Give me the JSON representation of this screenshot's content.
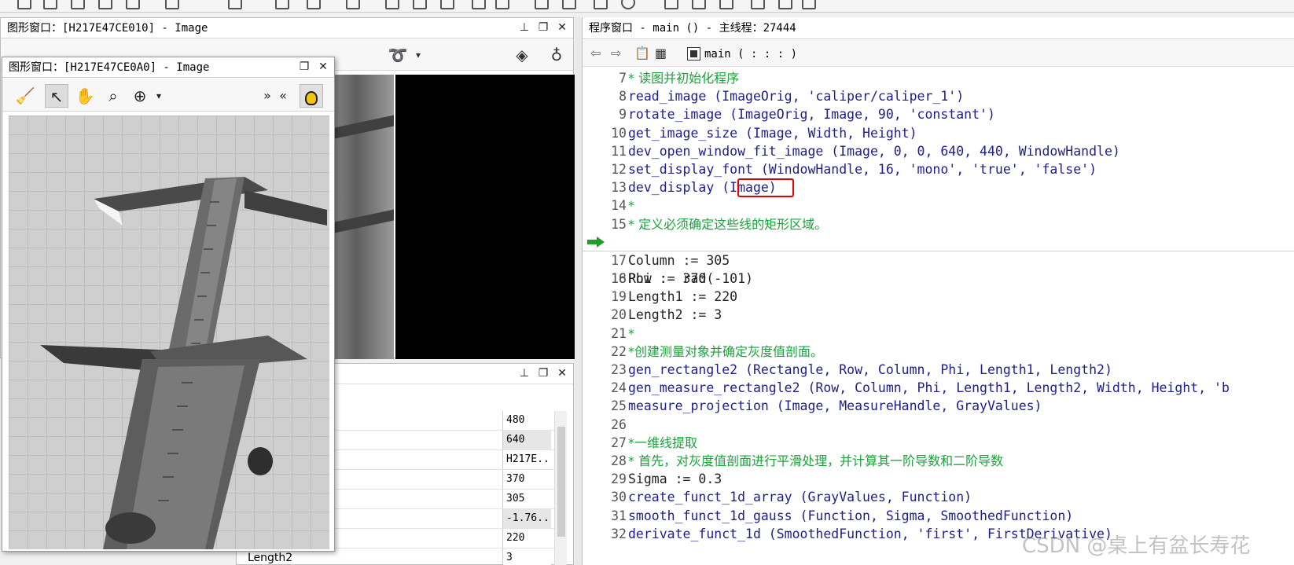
{
  "back_window": {
    "title": "图形窗口：[H217E47CE010] - Image"
  },
  "front_window": {
    "title": "图形窗口：[H217E47CE0A0] - Image"
  },
  "variable_window": {
    "rows": [
      {
        "name": "",
        "value": "480"
      },
      {
        "name": "",
        "value": "640"
      },
      {
        "name": "",
        "value": "H217E..."
      },
      {
        "name": "",
        "value": "370"
      },
      {
        "name": "",
        "value": "305"
      },
      {
        "name": "",
        "value": "-1.76..."
      },
      {
        "name": "",
        "value": "220"
      },
      {
        "name": "Length2",
        "value": "3"
      }
    ]
  },
  "program_window": {
    "title": "程序窗口 - main () - 主线程：27444",
    "procedure": "main ( : : : )",
    "lines": [
      {
        "n": "7",
        "kind": "cmt",
        "text": "* 读图并初始化程序"
      },
      {
        "n": "8",
        "kind": "op",
        "text": "read_image (ImageOrig, 'caliper/caliper_1')"
      },
      {
        "n": "9",
        "kind": "op",
        "text": "rotate_image (ImageOrig, Image, 90, 'constant')"
      },
      {
        "n": "10",
        "kind": "op",
        "text": "get_image_size (Image, Width, Height)"
      },
      {
        "n": "11",
        "kind": "op",
        "text": "dev_open_window_fit_image (Image, 0, 0, 640, 440, WindowHandle)"
      },
      {
        "n": "12",
        "kind": "op",
        "text": "set_display_font (WindowHandle, 16, 'mono', 'true', 'false')"
      },
      {
        "n": "13",
        "kind": "op",
        "text": "dev_display (Image)"
      },
      {
        "n": "14",
        "kind": "cmt",
        "text": "*"
      },
      {
        "n": "15",
        "kind": "cmt",
        "text": "* 定义必须确定这些线的矩形区域。"
      },
      {
        "n": "16",
        "kind": "asg",
        "text": "Row := 370"
      },
      {
        "n": "17",
        "kind": "asg",
        "text": "Column := 305"
      },
      {
        "n": "18",
        "kind": "asg",
        "text": "Phi := rad(-101)"
      },
      {
        "n": "19",
        "kind": "asg",
        "text": "Length1 := 220"
      },
      {
        "n": "20",
        "kind": "asg",
        "text": "Length2 := 3"
      },
      {
        "n": "21",
        "kind": "cmt",
        "text": "*"
      },
      {
        "n": "22",
        "kind": "cmt",
        "text": "*创建测量对象并确定灰度值剖面。"
      },
      {
        "n": "23",
        "kind": "op",
        "text": "gen_rectangle2 (Rectangle, Row, Column, Phi, Length1, Length2)"
      },
      {
        "n": "24",
        "kind": "op",
        "text": "gen_measure_rectangle2 (Row, Column, Phi, Length1, Length2, Width, Height, 'b"
      },
      {
        "n": "25",
        "kind": "op",
        "text": "measure_projection (Image, MeasureHandle, GrayValues)"
      },
      {
        "n": "26",
        "kind": "asg",
        "text": ""
      },
      {
        "n": "27",
        "kind": "cmt",
        "text": "*一维线提取"
      },
      {
        "n": "28",
        "kind": "cmt",
        "text": "* 首先，对灰度值剖面进行平滑处理，并计算其一阶导数和二阶导数"
      },
      {
        "n": "29",
        "kind": "asg",
        "text": "Sigma := 0.3"
      },
      {
        "n": "30",
        "kind": "op",
        "text": "create_funct_1d_array (GrayValues, Function)"
      },
      {
        "n": "31",
        "kind": "op",
        "text": "smooth_funct_1d_gauss (Function, Sigma, SmoothedFunction)"
      },
      {
        "n": "32",
        "kind": "op",
        "text": "derivate_funct_1d (SmoothedFunction, 'first', FirstDerivative)"
      }
    ]
  },
  "watermark": "CSDN @桌上有盆长寿花",
  "colors": {
    "comment": "#1aa33a",
    "operator": "#1e1e8c",
    "highlight_box": "#e00000",
    "bulb": "#f1c40f"
  }
}
